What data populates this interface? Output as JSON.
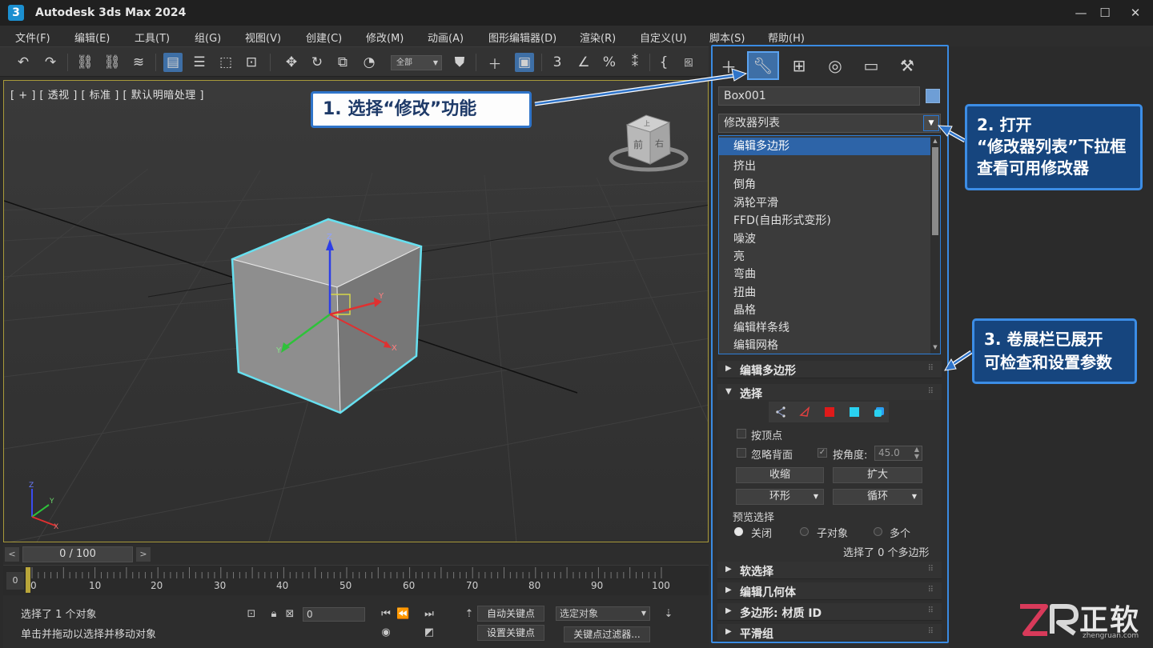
{
  "app": {
    "icon_label": "3",
    "title": "Autodesk 3ds Max 2024"
  },
  "window_controls": {
    "minimize": "—",
    "maximize": "☐",
    "close": "✕"
  },
  "menu": [
    "文件(F)",
    "编辑(E)",
    "工具(T)",
    "组(G)",
    "视图(V)",
    "创建(C)",
    "修改(M)",
    "动画(A)",
    "图形编辑器(D)",
    "渲染(R)",
    "自定义(U)",
    "脚本(S)",
    "帮助(H)"
  ],
  "toolbar": {
    "selection_filter": "全部",
    "named_sel": "囮"
  },
  "viewport": {
    "label": "[ + ] [ 透视 ] [ 标准 ] [ 默认明暗处理 ]",
    "viewcube_front": "前",
    "viewcube_right": "右",
    "viewcube_top": "上",
    "gizmo_x": "X",
    "gizmo_y": "Y",
    "gizmo_z": "Z"
  },
  "timeline": {
    "frame_counter": "0 / 100",
    "prev": "<",
    "next": ">",
    "zero": "0",
    "ticks": [
      "0",
      "10",
      "20",
      "30",
      "40",
      "50",
      "60",
      "70",
      "80",
      "90",
      "100"
    ]
  },
  "status": {
    "line1": "选择了 1 个对象",
    "line2": "单击并拖动以选择并移动对象",
    "coord_value": "0",
    "auto_key": "自动关键点",
    "set_key": "设置关键点",
    "selected_object": "选定对象",
    "key_filter": "关键点过滤器..."
  },
  "command_panel": {
    "object_name": "Box001",
    "object_color": "#6e9ed6",
    "modifier_list": "修改器列表",
    "modifiers": [
      "编辑多边形",
      "挤出",
      "倒角",
      "涡轮平滑",
      "FFD(自由形式变形)",
      "噪波",
      "亮",
      "弯曲",
      "扭曲",
      "晶格",
      "编辑样条线",
      "编辑网格"
    ],
    "rollouts": {
      "edit_poly": "编辑多边形",
      "selection": "选择",
      "soft_selection": "软选择",
      "edit_geometry": "编辑几何体",
      "poly_material": "多边形: 材质 ID",
      "smoothing_groups": "平滑组"
    },
    "selection": {
      "by_vertex": "按顶点",
      "ignore_backfacing": "忽略背面",
      "by_angle": "按角度:",
      "angle_value": "45.0",
      "shrink": "收缩",
      "grow": "扩大",
      "ring": "环形",
      "loop": "循环",
      "preview_selection": "预览选择",
      "preview_off": "关闭",
      "preview_subobject": "子对象",
      "preview_multi": "多个",
      "summary": "选择了 0 个多边形"
    }
  },
  "callouts": {
    "step1": "1. 选择“修改”功能",
    "step2_line1": "2. 打开",
    "step2_line2": "“修改器列表”下拉框",
    "step2_line3": "查看可用修改器",
    "step3_line1": "3. 卷展栏已展开",
    "step3_line2": "可检查和设置参数"
  },
  "logo": {
    "text": "正软",
    "url_text": "zhengruan.com"
  }
}
